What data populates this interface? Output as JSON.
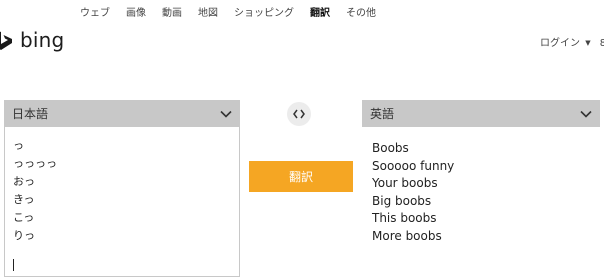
{
  "nav": {
    "items": [
      {
        "label": "ウェブ",
        "active": false
      },
      {
        "label": "画像",
        "active": false
      },
      {
        "label": "動画",
        "active": false
      },
      {
        "label": "地図",
        "active": false
      },
      {
        "label": "ショッピング",
        "active": false
      },
      {
        "label": "翻訳",
        "active": true
      },
      {
        "label": "その他",
        "active": false
      }
    ]
  },
  "brand": {
    "name": "bing",
    "logo_icon": "bing-logo-icon",
    "logo_color": "#1a1a1a"
  },
  "header": {
    "login_label": "ログイン",
    "login_caret": "▼",
    "login_suffix": "8"
  },
  "source": {
    "language": "日本語",
    "lines": [
      "っ",
      "っっっっ",
      "おっ",
      "きっ",
      "こっ",
      "りっ"
    ]
  },
  "target": {
    "language": "英語",
    "lines": [
      "Boobs",
      "Sooooo funny",
      "Your boobs",
      "Big boobs",
      "This boobs",
      "More boobs"
    ]
  },
  "swap": {
    "icon": "swap-arrows-icon"
  },
  "translate": {
    "label": "翻訳",
    "color": "#f5a623"
  },
  "colors": {
    "lang_bar_bg": "#c8c8c8",
    "accent": "#f5a623"
  }
}
